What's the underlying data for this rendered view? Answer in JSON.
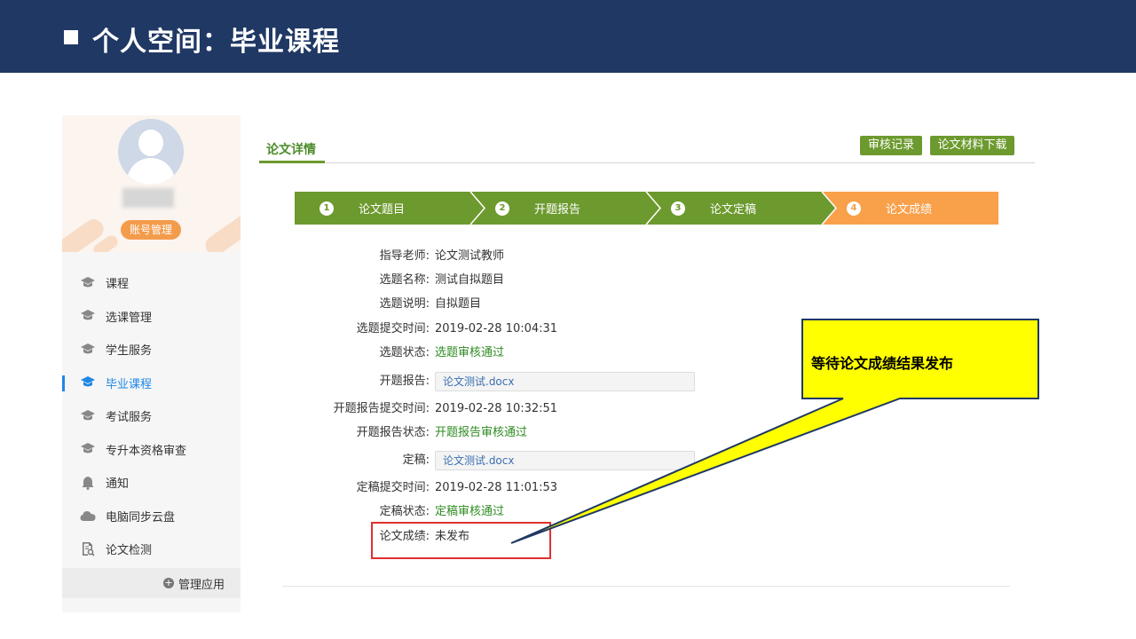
{
  "header": {
    "title": "个人空间：毕业课程"
  },
  "sidebar": {
    "account_button": "账号管理",
    "items": [
      {
        "label": "课程",
        "icon": "graduation-cap-icon"
      },
      {
        "label": "选课管理",
        "icon": "graduation-cap-icon"
      },
      {
        "label": "学生服务",
        "icon": "graduation-cap-icon"
      },
      {
        "label": "毕业课程",
        "icon": "graduation-cap-icon",
        "active": true
      },
      {
        "label": "考试服务",
        "icon": "graduation-cap-icon"
      },
      {
        "label": "专升本资格审查",
        "icon": "graduation-cap-icon"
      },
      {
        "label": "通知",
        "icon": "bell-icon"
      },
      {
        "label": "电脑同步云盘",
        "icon": "cloud-icon"
      },
      {
        "label": "论文检测",
        "icon": "document-search-icon"
      }
    ],
    "manage_label": "管理应用"
  },
  "main": {
    "tab_label": "论文详情",
    "buttons": {
      "review_record": "审核记录",
      "download_materials": "论文材料下载"
    },
    "steps": [
      {
        "num": "1",
        "label": "论文题目"
      },
      {
        "num": "2",
        "label": "开题报告"
      },
      {
        "num": "3",
        "label": "论文定稿"
      },
      {
        "num": "4",
        "label": "论文成绩"
      }
    ],
    "fields": [
      {
        "label": "指导老师:",
        "value": "论文测试教师"
      },
      {
        "label": "选题名称:",
        "value": "测试自拟题目"
      },
      {
        "label": "选题说明:",
        "value": "自拟题目"
      },
      {
        "label": "选题提交时间:",
        "value": "2019-02-28 10:04:31"
      },
      {
        "label": "选题状态:",
        "value": "选题审核通过"
      },
      {
        "label": "开题报告:",
        "value": "论文测试.docx"
      },
      {
        "label": "开题报告提交时间:",
        "value": "2019-02-28 10:32:51"
      },
      {
        "label": "开题报告状态:",
        "value": "开题报告审核通过"
      },
      {
        "label": "定稿:",
        "value": "论文测试.docx"
      },
      {
        "label": "定稿提交时间:",
        "value": "2019-02-28 11:01:53"
      },
      {
        "label": "定稿状态:",
        "value": "定稿审核通过"
      },
      {
        "label": "论文成绩:",
        "value": "未发布"
      }
    ]
  },
  "annotation": {
    "callout_text": "等待论文成绩结果发布"
  },
  "colors": {
    "header_bg": "#203864",
    "step_done": "#6c9a2e",
    "step_current": "#f9a04a",
    "status_green": "#2e8b22",
    "callout_yellow": "#ffff00",
    "highlight_red": "#e03030",
    "active_menu": "#1e88e5"
  }
}
